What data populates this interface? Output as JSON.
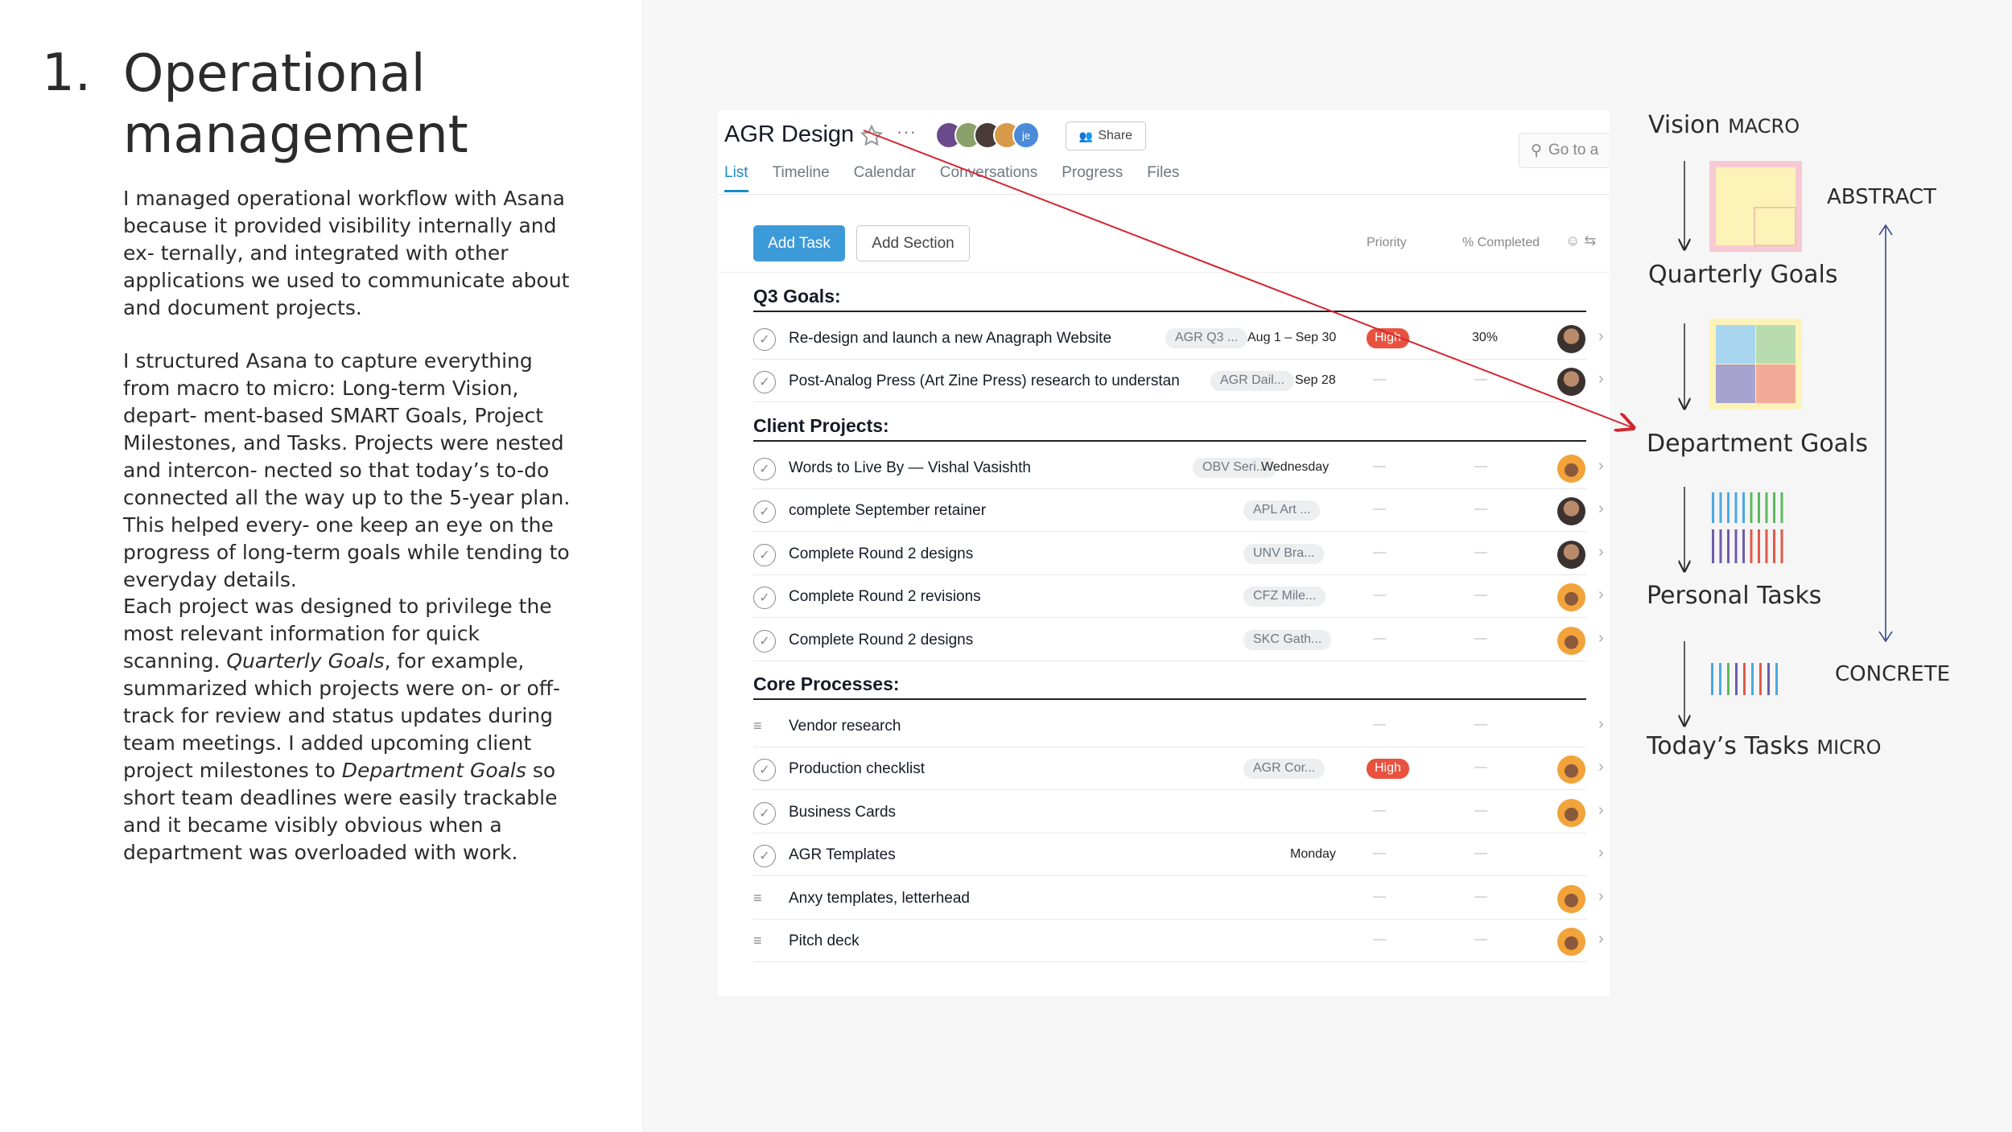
{
  "slide": {
    "number": "1.",
    "title_line1": "Operational",
    "title_line2": "management",
    "p1": "I managed operational workflow with Asana because it provided visibility internally and ex- ternally, and integrated with other applications we used to communicate about and document projects.",
    "p2": "I structured Asana to capture everything from macro to micro: Long-term Vision, depart- ment-based SMART Goals, Project Milestones, and Tasks. Projects were nested and intercon- nected so that today’s to-do connected all the way up to the 5-year plan. This helped every- one keep an eye on the progress of long-term goals while tending to everyday details.",
    "p3_a": "Each project was designed to privilege the most relevant information for quick scanning.",
    "p3_em1": "Quarterly Goals",
    "p3_b": ", for example, summarized which projects were on- or off-track for review and status updates during team meetings. I added upcoming client project milestones to",
    "p3_em2": "Department Goals",
    "p3_c": "so short team deadlines were easily trackable and it became visibly obvious when a department was overloaded with work."
  },
  "asana": {
    "project_title": "AGR Design",
    "avatar_initials": "je",
    "share_label": "Share",
    "search_placeholder": "Go to a",
    "tabs": [
      "List",
      "Timeline",
      "Calendar",
      "Conversations",
      "Progress",
      "Files"
    ],
    "add_task": "Add Task",
    "add_section": "Add Section",
    "col_priority": "Priority",
    "col_completed": "% Completed",
    "sections": [
      {
        "title": "Q3 Goals:",
        "rows": [
          {
            "name": "Re-design and launch a new Anagraph Website",
            "tag": "AGR Q3 ...",
            "due": "Aug 1 – Sep 30",
            "priority": "High",
            "pct": "30%",
            "avatar": "dark"
          },
          {
            "name": "Post-Analog Press (Art Zine Press) research to understan",
            "tag": "AGR Dail...",
            "due": "Sep 28",
            "avatar": "dark"
          }
        ]
      },
      {
        "title": "Client Projects:",
        "rows": [
          {
            "name": "Words to Live By — Vishal Vasishth",
            "tag": "OBV Seri...",
            "due": "Wednesday",
            "avatar": "orange"
          },
          {
            "name": "complete September retainer",
            "tag": "APL Art ...",
            "avatar": "dark"
          },
          {
            "name": "Complete Round 2 designs",
            "tag": "UNV Bra...",
            "avatar": "dark"
          },
          {
            "name": "Complete Round 2 revisions",
            "tag": "CFZ Mile...",
            "avatar": "orange"
          },
          {
            "name": "Complete Round 2 designs",
            "tag": "SKC Gath...",
            "avatar": "orange"
          }
        ]
      },
      {
        "title": "Core Processes:",
        "rows": [
          {
            "name": "Vendor research",
            "subtask": true
          },
          {
            "name": "Production checklist",
            "tag": "AGR Cor...",
            "priority": "High",
            "avatar": "orange"
          },
          {
            "name": "Business Cards",
            "avatar": "orange"
          },
          {
            "name": "AGR Templates",
            "due": "Monday"
          },
          {
            "name": "Anxy templates, letterhead",
            "subtask": true,
            "avatar": "orange"
          },
          {
            "name": "Pitch deck",
            "subtask": true,
            "avatar": "orange"
          }
        ]
      }
    ]
  },
  "diagram": {
    "vision": "Vision",
    "vision_tag": "MACRO",
    "quarterly": "Quarterly Goals",
    "department": "Department Goals",
    "personal": "Personal Tasks",
    "today": "Today’s Tasks",
    "today_tag": "MICRO",
    "abstract": "ABSTRACT",
    "concrete": "CONCRETE"
  },
  "colors": {
    "accent_blue": "#3d9ad8",
    "tab_blue": "#1a8cc7",
    "priority_high": "#e8523f",
    "arrow_red": "#d22630",
    "arrow_navy": "#2b3a8c"
  }
}
